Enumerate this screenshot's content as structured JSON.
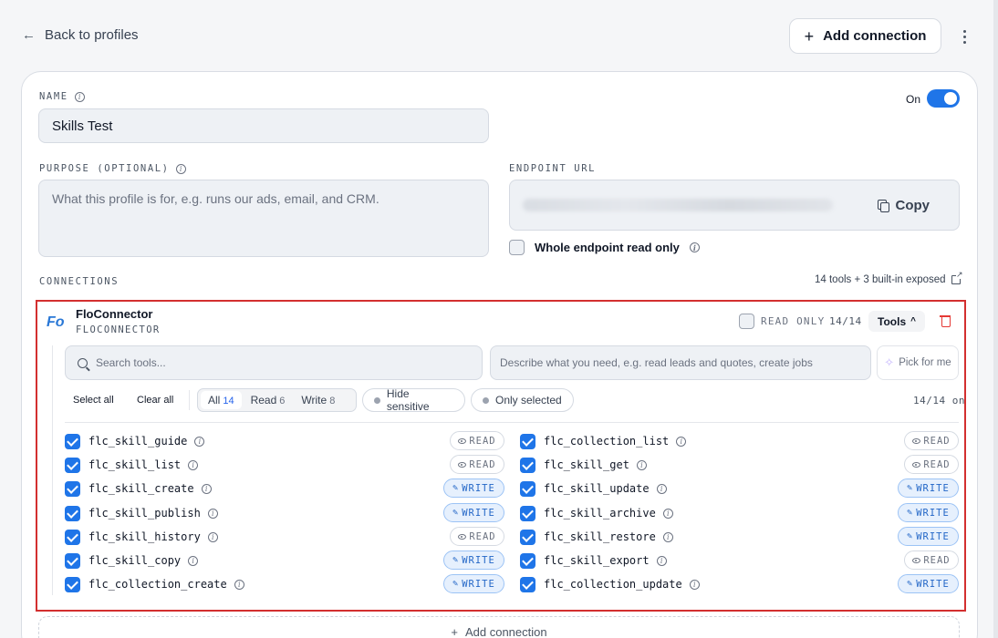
{
  "nav": {
    "back_label": "Back to profiles",
    "add_connection_label": "Add connection"
  },
  "profile": {
    "name_label": "NAME",
    "name_value": "Skills Test",
    "enabled_label": "On",
    "enabled": true,
    "purpose_label": "PURPOSE (OPTIONAL)",
    "purpose_placeholder": "What this profile is for, e.g. runs our ads, email, and CRM.",
    "endpoint_label": "ENDPOINT URL",
    "copy_label": "Copy",
    "whole_read_only_label": "Whole endpoint read only"
  },
  "connections": {
    "label": "CONNECTIONS",
    "summary": "14 tools + 3 built-in exposed",
    "add_label": "Add connection"
  },
  "connector": {
    "logo_text": "Fo",
    "title": "FloConnector",
    "subtitle": "FLOCONNECTOR",
    "read_only_label": "READ ONLY",
    "count": "14/14",
    "tools_label": "Tools",
    "search_placeholder": "Search tools...",
    "describe_placeholder": "Describe what you need, e.g. read leads and quotes, create jobs",
    "pick_label": "Pick for me",
    "select_all": "Select all",
    "clear_all": "Clear all",
    "filters": [
      {
        "label": "All",
        "count": "14"
      },
      {
        "label": "Read",
        "count": "6"
      },
      {
        "label": "Write",
        "count": "8"
      }
    ],
    "hide_sensitive": "Hide sensitive",
    "only_selected": "Only selected",
    "on_count": "14/14 on",
    "tools_left": [
      {
        "name": "flc_skill_guide",
        "access": "READ"
      },
      {
        "name": "flc_skill_list",
        "access": "READ"
      },
      {
        "name": "flc_skill_create",
        "access": "WRITE"
      },
      {
        "name": "flc_skill_publish",
        "access": "WRITE"
      },
      {
        "name": "flc_skill_history",
        "access": "READ"
      },
      {
        "name": "flc_skill_copy",
        "access": "WRITE"
      },
      {
        "name": "flc_collection_create",
        "access": "WRITE"
      }
    ],
    "tools_right": [
      {
        "name": "flc_collection_list",
        "access": "READ"
      },
      {
        "name": "flc_skill_get",
        "access": "READ"
      },
      {
        "name": "flc_skill_update",
        "access": "WRITE"
      },
      {
        "name": "flc_skill_archive",
        "access": "WRITE"
      },
      {
        "name": "flc_skill_restore",
        "access": "WRITE"
      },
      {
        "name": "flc_skill_export",
        "access": "READ"
      },
      {
        "name": "flc_collection_update",
        "access": "WRITE"
      }
    ]
  },
  "colors": {
    "accent": "#1f75e8",
    "highlight_border": "#d32f2f",
    "delete": "#e53935"
  }
}
